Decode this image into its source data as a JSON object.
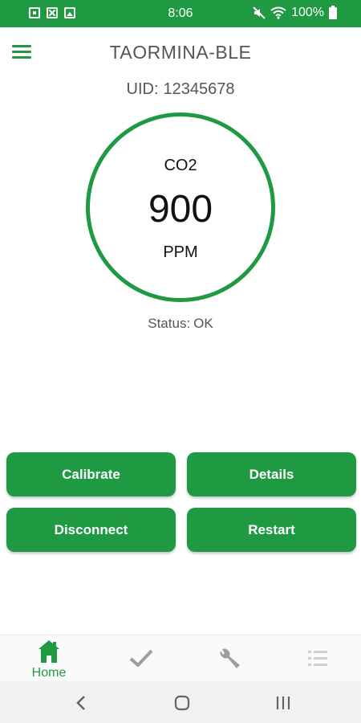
{
  "status_bar": {
    "time": "8:06",
    "battery": "100%",
    "left_icons": [
      "notification-icon",
      "close-box-icon",
      "image-icon"
    ],
    "right_icons": [
      "mute-icon",
      "wifi-icon",
      "battery-icon"
    ]
  },
  "app_bar": {
    "title": "TAORMINA-BLE",
    "menu_icon": "hamburger-menu-icon"
  },
  "device": {
    "uid_label": "UID:",
    "uid_value": "12345678"
  },
  "gauge": {
    "name": "CO2",
    "value": "900",
    "unit": "PPM"
  },
  "status": {
    "label": "Status:",
    "value": "OK"
  },
  "actions": {
    "calibrate": "Calibrate",
    "details": "Details",
    "disconnect": "Disconnect",
    "restart": "Restart"
  },
  "bottom_nav": {
    "items": [
      {
        "icon": "home-icon",
        "label": "Home",
        "active": true
      },
      {
        "icon": "check-icon",
        "label": "",
        "active": false
      },
      {
        "icon": "wrench-icon",
        "label": "",
        "active": false
      },
      {
        "icon": "list-icon",
        "label": "",
        "active": false
      }
    ]
  },
  "system_nav": [
    "back-icon",
    "home-circle-icon",
    "recents-icon"
  ],
  "colors": {
    "accent": "#1f9a43",
    "text_muted": "#555555",
    "inactive_icon": "#9e9e9e"
  }
}
